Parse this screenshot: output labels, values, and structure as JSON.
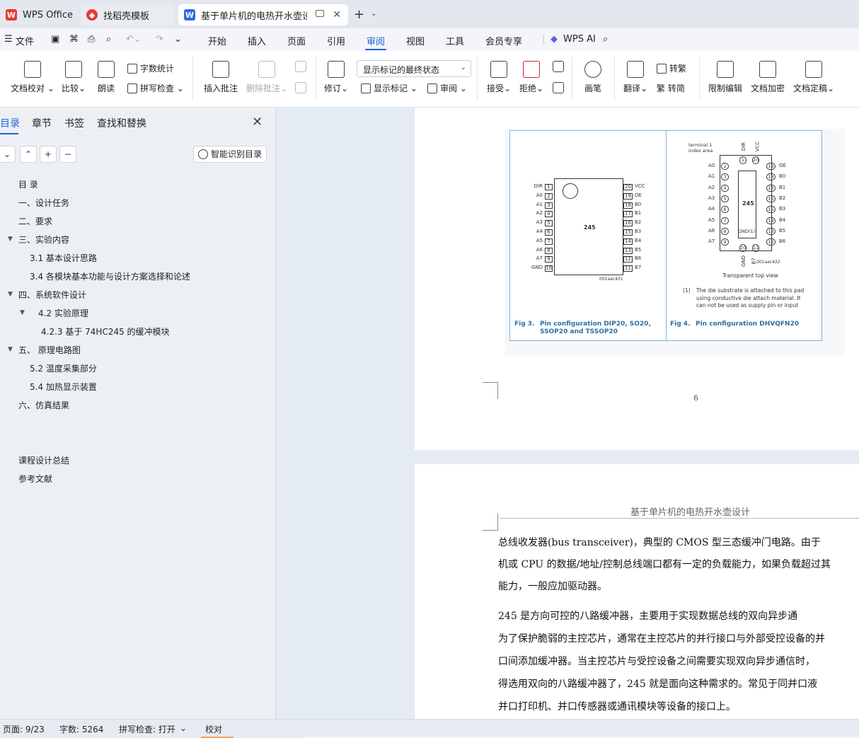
{
  "tabs": [
    {
      "label": "WPS Office",
      "icon": "wps-logo-icon"
    },
    {
      "label": "找稻壳模板",
      "icon": "docer-icon"
    },
    {
      "label": "基于单片机的电热开水壶设计",
      "icon": "word-doc-icon"
    }
  ],
  "menu": {
    "file": "文件",
    "items": [
      "开始",
      "插入",
      "页面",
      "引用",
      "审阅",
      "视图",
      "工具",
      "会员专享"
    ],
    "ai": "WPS AI"
  },
  "ribbon": {
    "doc_check": "文档校对",
    "compare": "比较",
    "read_aloud": "朗读",
    "word_count": "字数统计",
    "spell_check": "拼写检查",
    "insert_comment": "插入批注",
    "delete_comment": "删除批注",
    "track_changes": "修订",
    "markup_state": "显示标记的最终状态",
    "show_markup": "显示标记",
    "review": "审阅",
    "accept": "接受",
    "reject": "拒绝",
    "pen": "画笔",
    "translate": "翻译",
    "to_traditional": "转繁",
    "to_simplified": "繁 转简",
    "restrict_edit": "限制编辑",
    "encrypt": "文档加密",
    "finalize": "文档定稿"
  },
  "nav": {
    "tabs": [
      "目录",
      "章节",
      "书签",
      "查找和替换"
    ],
    "smart_toc": "智能识别目录",
    "toc": [
      "目  录",
      "一、设计任务",
      "二、要求",
      "三、实验内容",
      "3.1 基本设计思路",
      "3.4 各模块基本功能与设计方案选择和论述",
      "四、系统软件设计",
      "4.2 实验原理",
      "4.2.3 基于 74HC245 的缓冲模块",
      "五、 原理电路图",
      "5.2 温度采集部分",
      "5.4 加热显示装置",
      "六、仿真结果",
      "课程设计总结",
      "参考文献"
    ]
  },
  "figure": {
    "chip": "245",
    "dip_left": [
      "DIR",
      "A0",
      "A1",
      "A2",
      "A3",
      "A4",
      "A5",
      "A6",
      "A7",
      "GND"
    ],
    "dip_left_nums": [
      "1",
      "2",
      "3",
      "4",
      "5",
      "6",
      "7",
      "8",
      "9",
      "10"
    ],
    "dip_right": [
      "VCC",
      "OE",
      "B0",
      "B1",
      "B2",
      "B3",
      "B4",
      "B5",
      "B6",
      "B7"
    ],
    "dip_right_nums": [
      "20",
      "19",
      "18",
      "17",
      "16",
      "15",
      "14",
      "13",
      "12",
      "11"
    ],
    "dip_code": "001aac431",
    "qfn_code": "001aac432",
    "terminal_label": "terminal 1\nindex area",
    "qfn_left": [
      "A0",
      "A1",
      "A2",
      "A3",
      "A4",
      "A5",
      "A6",
      "A7"
    ],
    "qfn_left_nums": [
      "2",
      "3",
      "4",
      "5",
      "6",
      "7",
      "8",
      "9"
    ],
    "qfn_right": [
      "OE",
      "B0",
      "B1",
      "B2",
      "B3",
      "B4",
      "B5",
      "B6"
    ],
    "qfn_right_nums": [
      "19",
      "18",
      "17",
      "16",
      "15",
      "14",
      "13",
      "12"
    ],
    "qfn_top": [
      "DIR",
      "VCC"
    ],
    "qfn_top_nums": [
      "1",
      "20"
    ],
    "qfn_bottom": [
      "GND",
      "B7"
    ],
    "qfn_bottom_nums": [
      "10",
      "11"
    ],
    "gnd_label": "GND(1)",
    "transparent": "Transparent top view",
    "note_num": "(1)",
    "note": "The die substrate is attached to this pad using conductive die attach material. It can not be used as supply pin or input",
    "cap3_num": "Fig 3.",
    "cap3": "Pin configuration DIP20, SO20, SSOP20 and TSSOP20",
    "cap4_num": "Fig 4.",
    "cap4": "Pin configuration DHVQFN20"
  },
  "page_number": "6",
  "page2": {
    "running_head": "基于单片机的电热开水壶设计",
    "lines": [
      "    总线收发器(bus transceiver)，典型的 CMOS 型三态缓冲门电路。由于",
      "机或 CPU 的数据/地址/控制总线端口都有一定的负载能力，如果负载超过其",
      "能力，一般应加驱动器。",
      "    245 是方向可控的八路缓冲器，主要用于实现数据总线的双向异步通",
      "为了保护脆弱的主控芯片，通常在主控芯片的并行接口与外部受控设备的并",
      "口间添加缓冲器。当主控芯片与受控设备之间需要实现双向异步通信时，",
      "得选用双向的八路缓冲器了，245 就是面向这种需求的。常见于同并口液",
      "并口打印机、并口传感器或通讯模块等设备的接口上。"
    ]
  },
  "status": {
    "page": "页面: 9/23",
    "words": "字数: 5264",
    "spell": "拼写检查: 打开",
    "proof": "校对"
  }
}
